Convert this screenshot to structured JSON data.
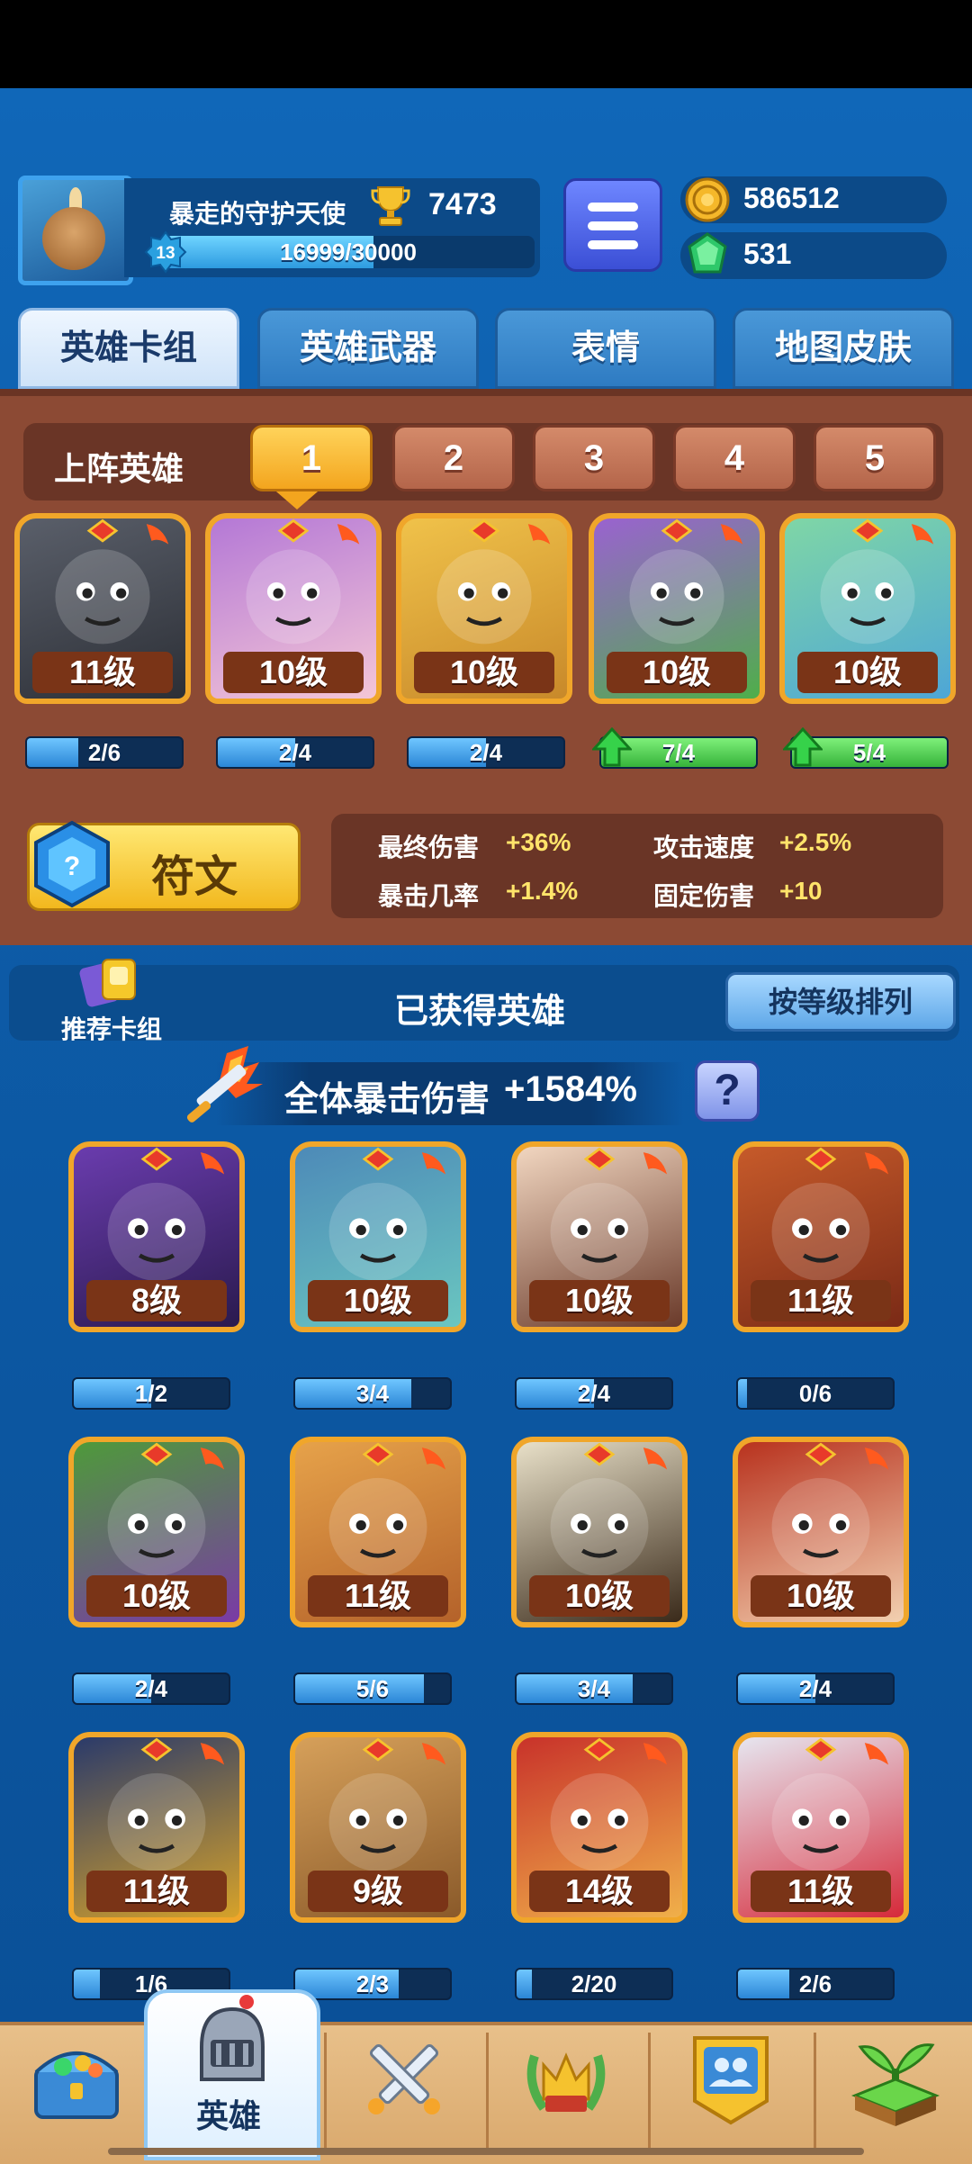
{
  "player": {
    "name": "暴走的守护天使",
    "trophies": "7473",
    "level": "13",
    "xp_text": "16999/30000",
    "xp_fraction": 0.567
  },
  "currency": {
    "gold": "586512",
    "gems": "531"
  },
  "tabs": [
    {
      "label": "英雄卡组",
      "active": true
    },
    {
      "label": "英雄武器",
      "active": false
    },
    {
      "label": "表情",
      "active": false
    },
    {
      "label": "地图皮肤",
      "active": false
    }
  ],
  "team": {
    "label": "上阵英雄",
    "slots": [
      "1",
      "2",
      "3",
      "4",
      "5"
    ],
    "active_slot": "1",
    "heroes": [
      {
        "level": "11级",
        "progress": "2/6",
        "fraction": 0.333,
        "upgradable": false,
        "palette": [
          "#5a5f6a",
          "#2c2f36"
        ]
      },
      {
        "level": "10级",
        "progress": "2/4",
        "fraction": 0.5,
        "upgradable": false,
        "palette": [
          "#b478d6",
          "#f4c6d6"
        ]
      },
      {
        "level": "10级",
        "progress": "2/4",
        "fraction": 0.5,
        "upgradable": false,
        "palette": [
          "#f0c24a",
          "#c8892a"
        ]
      },
      {
        "level": "10级",
        "progress": "7/4",
        "fraction": 1.0,
        "upgradable": true,
        "palette": [
          "#9a62d0",
          "#4fae4a"
        ]
      },
      {
        "level": "10级",
        "progress": "5/4",
        "fraction": 1.0,
        "upgradable": true,
        "palette": [
          "#7fd6a6",
          "#4ea6d6"
        ]
      }
    ]
  },
  "rune": {
    "label": "符文"
  },
  "stats": [
    {
      "label": "最终伤害",
      "value": "+36%"
    },
    {
      "label": "攻击速度",
      "value": "+2.5%"
    },
    {
      "label": "暴击几率",
      "value": "+1.4%"
    },
    {
      "label": "固定伤害",
      "value": "+10"
    }
  ],
  "owned": {
    "recommend_label": "推荐卡组",
    "title": "已获得英雄",
    "sort_label": "按等级排列",
    "crit_label": "全体暴击伤害",
    "crit_value": "+1584%",
    "help_label": "?"
  },
  "heroes": [
    {
      "level": "8级",
      "progress": "1/2",
      "fraction": 0.5,
      "palette": [
        "#6a3cae",
        "#2a1a4e"
      ]
    },
    {
      "level": "10级",
      "progress": "3/4",
      "fraction": 0.75,
      "palette": [
        "#4d8ab8",
        "#6ac6c0"
      ]
    },
    {
      "level": "10级",
      "progress": "2/4",
      "fraction": 0.5,
      "palette": [
        "#f1d6c0",
        "#6a3a2a"
      ]
    },
    {
      "level": "11级",
      "progress": "0/6",
      "fraction": 0.0,
      "palette": [
        "#c65a2a",
        "#7a2a16"
      ]
    },
    {
      "level": "10级",
      "progress": "2/4",
      "fraction": 0.5,
      "palette": [
        "#4e9a3a",
        "#7a3aa6"
      ]
    },
    {
      "level": "11级",
      "progress": "5/6",
      "fraction": 0.833,
      "palette": [
        "#e6a24a",
        "#b4622a"
      ]
    },
    {
      "level": "10级",
      "progress": "3/4",
      "fraction": 0.75,
      "palette": [
        "#e8e0c8",
        "#3a2a1a"
      ]
    },
    {
      "level": "10级",
      "progress": "2/4",
      "fraction": 0.5,
      "palette": [
        "#b8321e",
        "#f2d0b0"
      ]
    },
    {
      "level": "11级",
      "progress": "1/6",
      "fraction": 0.167,
      "palette": [
        "#2a3a6a",
        "#d6a22a"
      ]
    },
    {
      "level": "9级",
      "progress": "2/3",
      "fraction": 0.667,
      "palette": [
        "#d6a05a",
        "#8a5a2a"
      ]
    },
    {
      "level": "14级",
      "progress": "2/20",
      "fraction": 0.1,
      "palette": [
        "#c8322a",
        "#f0b04a"
      ]
    },
    {
      "level": "11级",
      "progress": "2/6",
      "fraction": 0.333,
      "palette": [
        "#e6e6f0",
        "#d62a3a"
      ]
    }
  ],
  "nav": {
    "items": [
      {
        "name": "nav-chest",
        "icon": "chest-icon"
      },
      {
        "name": "nav-heroes",
        "icon": "helmet-icon",
        "label": "英雄",
        "active": true
      },
      {
        "name": "nav-battle",
        "icon": "crossed-swords-icon"
      },
      {
        "name": "nav-rank",
        "icon": "crown-icon"
      },
      {
        "name": "nav-social",
        "icon": "people-icon"
      },
      {
        "name": "nav-island",
        "icon": "island-icon"
      }
    ]
  },
  "colors": {
    "accent_gold": "#f0a62a",
    "xp_blue": "#2d9be0",
    "upgrade_green": "#36b33a",
    "stat_yellow": "#ffe46a"
  }
}
